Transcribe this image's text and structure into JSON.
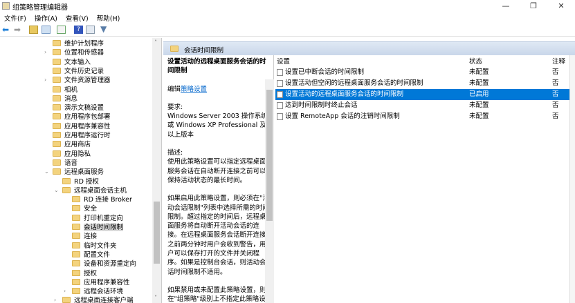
{
  "window": {
    "title": "组策略管理编辑器",
    "minimize": "—",
    "maximize": "❐",
    "close": "✕"
  },
  "menu": [
    "文件(F)",
    "操作(A)",
    "查看(V)",
    "帮助(H)"
  ],
  "tree": [
    {
      "label": "维护计划程序",
      "level": 2
    },
    {
      "label": "位置和传感器",
      "level": 2,
      "expand": "›"
    },
    {
      "label": "文本输入",
      "level": 2
    },
    {
      "label": "文件历史记录",
      "level": 2
    },
    {
      "label": "文件资源管理器",
      "level": 2,
      "expand": "›"
    },
    {
      "label": "相机",
      "level": 2
    },
    {
      "label": "消息",
      "level": 2
    },
    {
      "label": "演示文稿设置",
      "level": 2
    },
    {
      "label": "应用程序包部署",
      "level": 2
    },
    {
      "label": "应用程序兼容性",
      "level": 2
    },
    {
      "label": "应用程序运行时",
      "level": 2
    },
    {
      "label": "应用商店",
      "level": 2
    },
    {
      "label": "应用隐私",
      "level": 2
    },
    {
      "label": "语音",
      "level": 2
    },
    {
      "label": "远程桌面服务",
      "level": 2,
      "expand": "⌄"
    },
    {
      "label": "RD 授权",
      "level": 3
    },
    {
      "label": "远程桌面会话主机",
      "level": 3,
      "expand": "⌄"
    },
    {
      "label": "RD 连接 Broker",
      "level": 4
    },
    {
      "label": "安全",
      "level": 4
    },
    {
      "label": "打印机重定向",
      "level": 4
    },
    {
      "label": "会话时间限制",
      "level": 4,
      "selected": true
    },
    {
      "label": "连接",
      "level": 4
    },
    {
      "label": "临时文件夹",
      "level": 4
    },
    {
      "label": "配置文件",
      "level": 4
    },
    {
      "label": "设备和资源重定向",
      "level": 4
    },
    {
      "label": "授权",
      "level": 4
    },
    {
      "label": "应用程序兼容性",
      "level": 4
    },
    {
      "label": "远程会话环境",
      "level": 4,
      "expand": "›"
    },
    {
      "label": "远程桌面连接客户端",
      "level": 3,
      "expand": "›"
    }
  ],
  "header": {
    "title": "会话时间限制"
  },
  "description": {
    "title": "设置活动的远程桌面服务会话的时间限制",
    "edit_prefix": "编辑",
    "edit_link": "策略设置",
    "req_label": "要求:",
    "req_text": "Windows Server 2003 操作系统或 Windows XP Professional 及以上版本",
    "desc_label": "描述:",
    "desc_text": "使用此策略设置可以指定远程桌面服务会话在自动断开连接之前可以保持活动状态的最长时间。",
    "para2": "如果启用此策略设置，则必须在\"活动会话限制\"列表中选择所需的时间限制。超过指定的时间后，远程桌面服务将自动断开活动会话的连接。在远程桌面服务会话断开连接之前两分钟时用户会收到警告，用户可以保存打开的文件并关闭程序。如果是控制台会话，则活动会话时间限制不适用。",
    "para3": "如果禁用或未配置此策略设置，则在\"组策略\"级别上不指定此策略设置。默认情况下，远程桌面服务允"
  },
  "list": {
    "columns": [
      "设置",
      "状态",
      "注释"
    ],
    "rows": [
      {
        "name": "设置已中断会话的时间限制",
        "state": "未配置",
        "comment": "否"
      },
      {
        "name": "设置活动但空闲的远程桌面服务会话的时间限制",
        "state": "未配置",
        "comment": "否"
      },
      {
        "name": "设置活动的远程桌面服务会话的时间限制",
        "state": "已启用",
        "comment": "否",
        "selected": true
      },
      {
        "name": "达到时间限制时终止会话",
        "state": "未配置",
        "comment": "否"
      },
      {
        "name": "设置 RemoteApp 会话的注销时间限制",
        "state": "未配置",
        "comment": "否"
      }
    ]
  },
  "colors": {
    "accent": "#0078d7"
  }
}
